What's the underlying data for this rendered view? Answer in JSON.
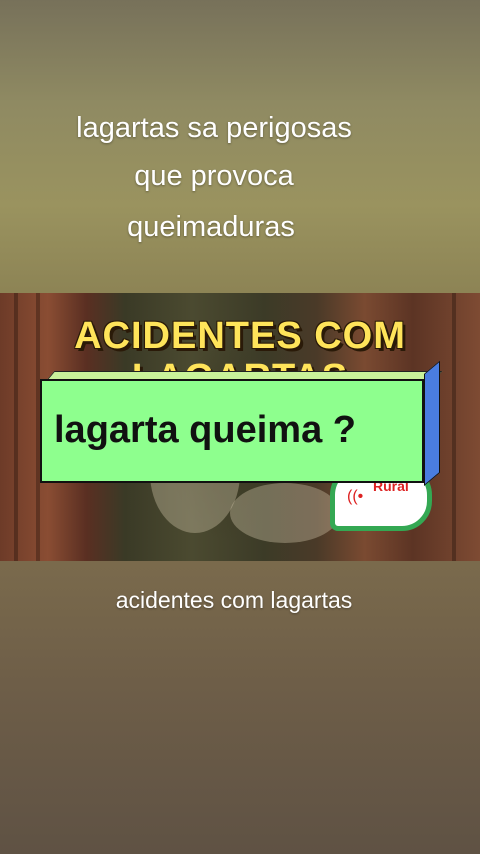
{
  "caption_top": {
    "line1": "lagartas sa perigosas",
    "line2": "que provoca",
    "line3": "queimaduras"
  },
  "video": {
    "banner_line1": "ACIDENTES COM",
    "banner_line2": "LAGARTAS",
    "logo_text": "Rural",
    "logo_icon": "wifi-signal-icon"
  },
  "question_box": {
    "text": "lagarta queima ?",
    "colors": {
      "face": "#8eff8e",
      "side": "#4a7de0",
      "top": "#c9f29a"
    }
  },
  "caption_bottom": "acidentes com lagartas"
}
